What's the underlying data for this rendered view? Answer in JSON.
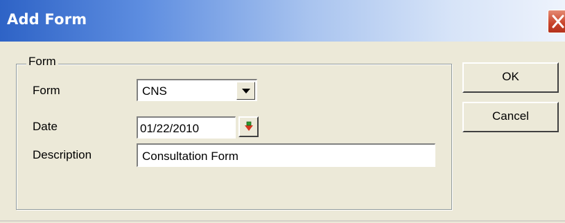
{
  "window": {
    "title": "Add Form"
  },
  "group": {
    "legend": "Form",
    "form_label": "Form",
    "form_value": "CNS",
    "date_label": "Date",
    "date_value": "01/22/2010",
    "description_label": "Description",
    "description_value": "Consultation Form"
  },
  "buttons": {
    "ok": "OK",
    "cancel": "Cancel"
  },
  "icons": {
    "close": "close-icon",
    "dropdown": "chevron-down-icon",
    "date_picker": "calendar-arrow-icon"
  },
  "colors": {
    "title_gradient_start": "#2e63c6",
    "close_button": "#c8432a",
    "dialog_background": "#ece9d8"
  }
}
